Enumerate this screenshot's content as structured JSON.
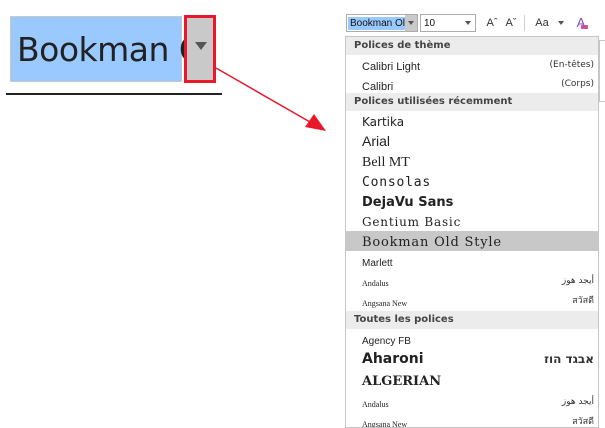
{
  "zoom": {
    "font_name": "Bookman Ol"
  },
  "ribbon": {
    "font_name": "Bookman Ol",
    "font_size": "10",
    "grow_label": "Aˆ",
    "shrink_label": "Aˇ",
    "case_label": "Aa",
    "clear_label": "A"
  },
  "dropdown": {
    "theme_header": "Polices de thème",
    "theme_fonts": [
      {
        "name": "Calibri Light",
        "sample": "(En-têtes)"
      },
      {
        "name": "Calibri",
        "sample": "(Corps)"
      }
    ],
    "recent_header": "Polices utilisées récemment",
    "recent_fonts": [
      {
        "name": "Kartika",
        "sample": ""
      },
      {
        "name": "Arial",
        "sample": ""
      },
      {
        "name": "Bell MT",
        "sample": ""
      },
      {
        "name": "Consolas",
        "sample": ""
      },
      {
        "name": "DejaVu Sans",
        "sample": ""
      },
      {
        "name": "Gentium Basic",
        "sample": ""
      },
      {
        "name": "Bookman Old Style",
        "sample": ""
      },
      {
        "name": "Marlett",
        "sample": ""
      },
      {
        "name": "Andalus",
        "sample": "أيجد هوز"
      },
      {
        "name": "Angsana New",
        "sample": "สวัสดี"
      }
    ],
    "all_header": "Toutes les polices",
    "all_fonts": [
      {
        "name": "Agency FB",
        "sample": ""
      },
      {
        "name": "Aharoni",
        "sample": "אבגד הוז"
      },
      {
        "name": "ALGERIAN",
        "sample": ""
      },
      {
        "name": "Andalus",
        "sample": "أيجد هوز"
      },
      {
        "name": "Angsana New",
        "sample": "สวัสดี"
      }
    ],
    "selected_font": "Bookman Old Style"
  },
  "colors": {
    "selection": "#99c9ff",
    "highlight_border": "#e8182b",
    "arrow": "#e8182b",
    "selected_row": "#c8c8c8",
    "section_header": "#ececec"
  }
}
